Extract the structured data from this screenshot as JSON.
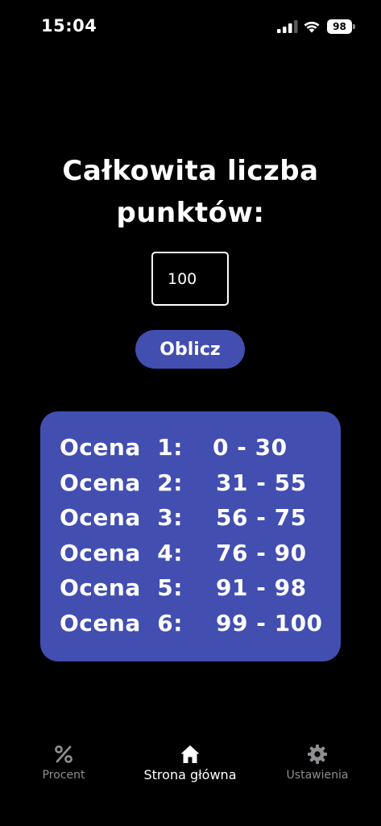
{
  "status_bar": {
    "time": "15:04",
    "battery": "98"
  },
  "main": {
    "title": "Całkowita liczba punktów:",
    "points_input_value": "100",
    "calculate_button_label": "Oblicz"
  },
  "results": [
    {
      "label": "Ocena  1:",
      "range": "0 - 30"
    },
    {
      "label": "Ocena  2:",
      "range": "31 - 55"
    },
    {
      "label": "Ocena  3:",
      "range": "56 - 75"
    },
    {
      "label": "Ocena  4:",
      "range": "76 - 90"
    },
    {
      "label": "Ocena  5:",
      "range": "91 - 98"
    },
    {
      "label": "Ocena  6:",
      "range": "99 - 100"
    }
  ],
  "tabs": [
    {
      "label": "Procent",
      "icon": "percent-icon",
      "active": false
    },
    {
      "label": "Strona główna",
      "icon": "home-icon",
      "active": true
    },
    {
      "label": "Ustawienia",
      "icon": "gear-icon",
      "active": false
    }
  ],
  "colors": {
    "background": "#000000",
    "accent": "#424eb0",
    "inactive_tab": "#8e8e93",
    "text": "#ffffff"
  }
}
